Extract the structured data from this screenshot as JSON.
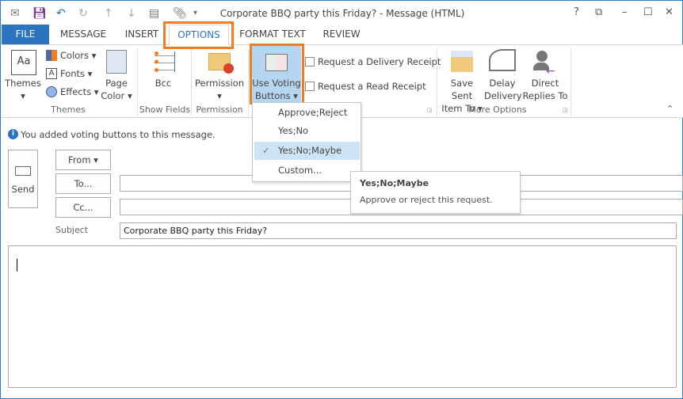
{
  "window": {
    "title": "Corporate BBQ party this Friday? - Message (HTML)",
    "help": "?",
    "restore_ribbon": "⧉",
    "minimize": "–",
    "maximize": "☐",
    "close": "✕"
  },
  "qat": {
    "icons": [
      "new-message-icon",
      "save-icon",
      "undo-icon",
      "redo-icon",
      "up-icon",
      "down-icon",
      "attach-item-icon",
      "attach-file-icon",
      "customize-icon"
    ]
  },
  "tabs": [
    "FILE",
    "MESSAGE",
    "INSERT",
    "OPTIONS",
    "FORMAT TEXT",
    "REVIEW"
  ],
  "active_tab": "OPTIONS",
  "ribbon": {
    "themes": {
      "themes": "Themes",
      "colors": "Colors",
      "fonts": "Fonts",
      "effects": "Effects",
      "page_color_1": "Page",
      "page_color_2": "Color",
      "group": "Themes"
    },
    "show_fields": {
      "bcc": "Bcc",
      "group": "Show Fields"
    },
    "permission": {
      "permission": "Permission",
      "group": "Permission"
    },
    "tracking": {
      "voting_1": "Use Voting",
      "voting_2": "Buttons",
      "delivery_receipt": "Request a Delivery Receipt",
      "read_receipt": "Request a Read Receipt"
    },
    "more_options": {
      "save_sent_1": "Save Sent",
      "save_sent_2": "Item To",
      "delay_1": "Delay",
      "delay_2": "Delivery",
      "direct_1": "Direct",
      "direct_2": "Replies To",
      "group": "More Options"
    }
  },
  "voting_menu": {
    "items": [
      "Approve;Reject",
      "Yes;No",
      "Yes;No;Maybe",
      "Custom..."
    ],
    "selected": "Yes;No;Maybe"
  },
  "tooltip": {
    "title": "Yes;No;Maybe",
    "body": "Approve or reject this request."
  },
  "info_bar": "You added voting buttons to this message.",
  "compose": {
    "send": "Send",
    "from": "From",
    "to": "To...",
    "cc": "Cc...",
    "subject_label": "Subject",
    "to_value": "",
    "cc_value": "",
    "subject_value": "Corporate BBQ party this Friday?",
    "body": ""
  },
  "colors": {
    "accent": "#2b74c2",
    "highlight": "#f47b20",
    "selected": "#cde4f7"
  }
}
